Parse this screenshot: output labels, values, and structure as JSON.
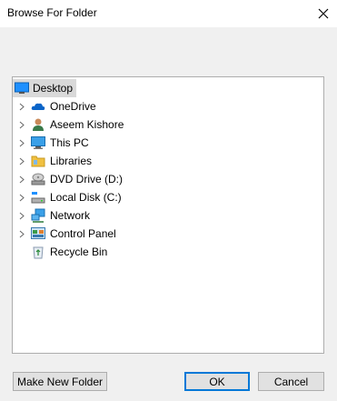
{
  "window": {
    "title": "Browse For Folder"
  },
  "tree": {
    "items": [
      {
        "label": "Desktop",
        "icon": "desktop-icon",
        "selected": true
      },
      {
        "label": "OneDrive",
        "icon": "onedrive-icon"
      },
      {
        "label": "Aseem Kishore",
        "icon": "user-folder-icon"
      },
      {
        "label": "This PC",
        "icon": "computer-icon"
      },
      {
        "label": "Libraries",
        "icon": "libraries-icon"
      },
      {
        "label": "DVD Drive (D:)",
        "icon": "dvd-drive-icon"
      },
      {
        "label": "Local Disk (C:)",
        "icon": "local-disk-icon"
      },
      {
        "label": "Network",
        "icon": "network-icon"
      },
      {
        "label": "Control Panel",
        "icon": "control-panel-icon"
      },
      {
        "label": "Recycle Bin",
        "icon": "recycle-bin-icon"
      }
    ]
  },
  "buttons": {
    "make_new_folder": "Make New Folder",
    "ok": "OK",
    "cancel": "Cancel"
  },
  "colors": {
    "accent": "#0078d7",
    "selection": "#d9d9d9",
    "dialog_bg": "#f0f0f0"
  }
}
